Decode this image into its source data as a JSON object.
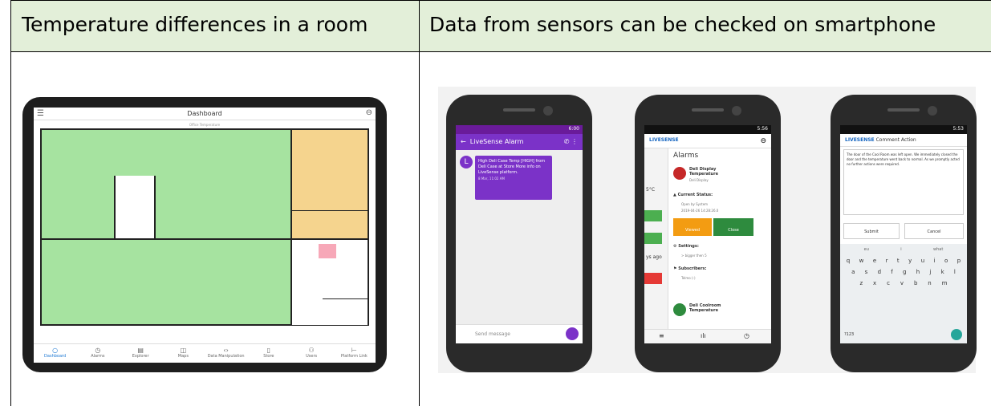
{
  "table": {
    "header_left": "Temperature differences in a room",
    "header_right": "Data from sensors can be checked on smartphone"
  },
  "tablet": {
    "title": "Dashboard",
    "subtitle": "Office Temperature",
    "nav": [
      "Dashboard",
      "Alarms",
      "Explorer",
      "Maps",
      "Data Manipulation",
      "Store",
      "Users",
      "Platform Link"
    ]
  },
  "phone1": {
    "app_bar": "LiveSense Alarm",
    "avatar": "L",
    "message": "High Deli Case Temp [HIGH] from Deli Case at Store More info on LiveSense platform.",
    "time": "8 Mar, 11:02 AM",
    "input_placeholder": "Send message",
    "clock": "6:00"
  },
  "phone2": {
    "brand": "LIVESENSE",
    "heading": "Alarms",
    "item1_title": "Deli Display Temperature",
    "item1_sub": "Deli Display",
    "status_label": "Current Status:",
    "status_text": "Open by System",
    "status_time": "2019-04-26 14:28:26.0",
    "btn_viewed": "Viewed",
    "btn_close": "Close",
    "settings_label": "Settings:",
    "settings_text": "> bigger then 5",
    "subscribers_label": "Subscribers:",
    "subscribers_text": "Telmo (-)",
    "item2_title": "Deli Coolroom Temperature",
    "side_temp": "5°C",
    "side_ago": "ys ago",
    "clock": "5:56"
  },
  "phone3": {
    "brand": "LIVESENSE",
    "title": "Comment Action",
    "comment": "The door of the Cool Room was left open. We immediately closed the door and the temperature went back to normal. As we promptly acted no further actions were required.",
    "submit": "Submit",
    "cancel": "Cancel",
    "suggestions": [
      "eu",
      "i",
      "what"
    ],
    "row1": [
      "q",
      "w",
      "e",
      "r",
      "t",
      "y",
      "u",
      "i",
      "o",
      "p"
    ],
    "row2": [
      "a",
      "s",
      "d",
      "f",
      "g",
      "h",
      "j",
      "k",
      "l"
    ],
    "row3": [
      "z",
      "x",
      "c",
      "v",
      "b",
      "n",
      "m"
    ],
    "symbols": "?123",
    "clock": "5:53"
  },
  "colors": {
    "header_bg": "#e3efd9",
    "plan_green": "#a6e3a0",
    "plan_orange": "#f5d48e",
    "purple": "#7b32c8",
    "green_btn": "#2e8b3e",
    "orange_btn": "#f39c12",
    "red_dot": "#c62828"
  }
}
